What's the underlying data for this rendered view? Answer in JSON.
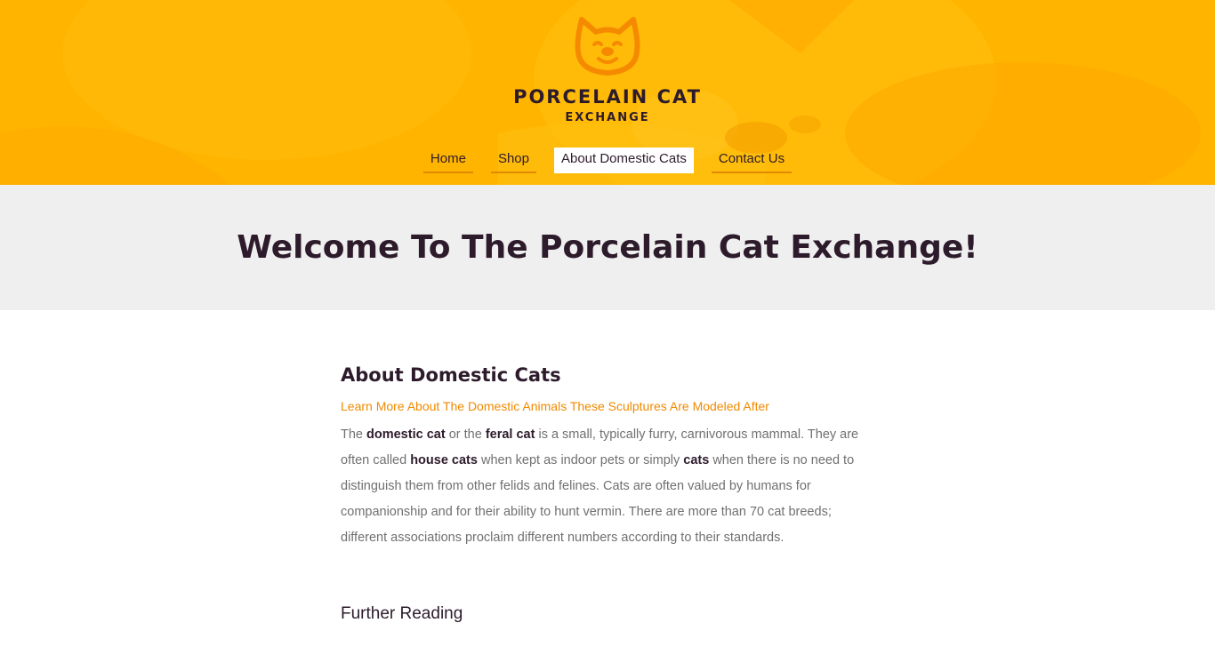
{
  "colors": {
    "header_bg": "#ffb400",
    "accent": "#f08a00",
    "dark_text": "#2d1b2b",
    "hero_bg": "#efefef",
    "body_text": "#707070"
  },
  "header": {
    "logo_icon": "cat-face-icon",
    "logo_title": "PORCELAIN CAT",
    "logo_subtitle": "EXCHANGE"
  },
  "nav": {
    "items": [
      {
        "label": "Home",
        "active": false
      },
      {
        "label": "Shop",
        "active": false
      },
      {
        "label": "About Domestic Cats",
        "active": true
      },
      {
        "label": "Contact Us",
        "active": false
      }
    ]
  },
  "hero": {
    "title": "Welcome To The Porcelain Cat Exchange!"
  },
  "main": {
    "heading": "About Domestic Cats",
    "subtitle": "Learn More About The Domestic Animals These Sculptures Are Modeled After",
    "paragraph": {
      "t1": "The ",
      "b1": "domestic cat",
      "t2": " or the ",
      "b2": "feral cat",
      "t3": " is a small, typically furry, carnivorous mammal. They are often called ",
      "b3": "house cats",
      "t4": " when kept as indoor pets or simply ",
      "b4": "cats",
      "t5": " when there is no need to distinguish them from other felids and felines. Cats are often valued by humans for companionship and for their ability to hunt vermin. There are more than 70 cat breeds; different associations proclaim different numbers according to their standards."
    },
    "further_reading": "Further Reading"
  }
}
